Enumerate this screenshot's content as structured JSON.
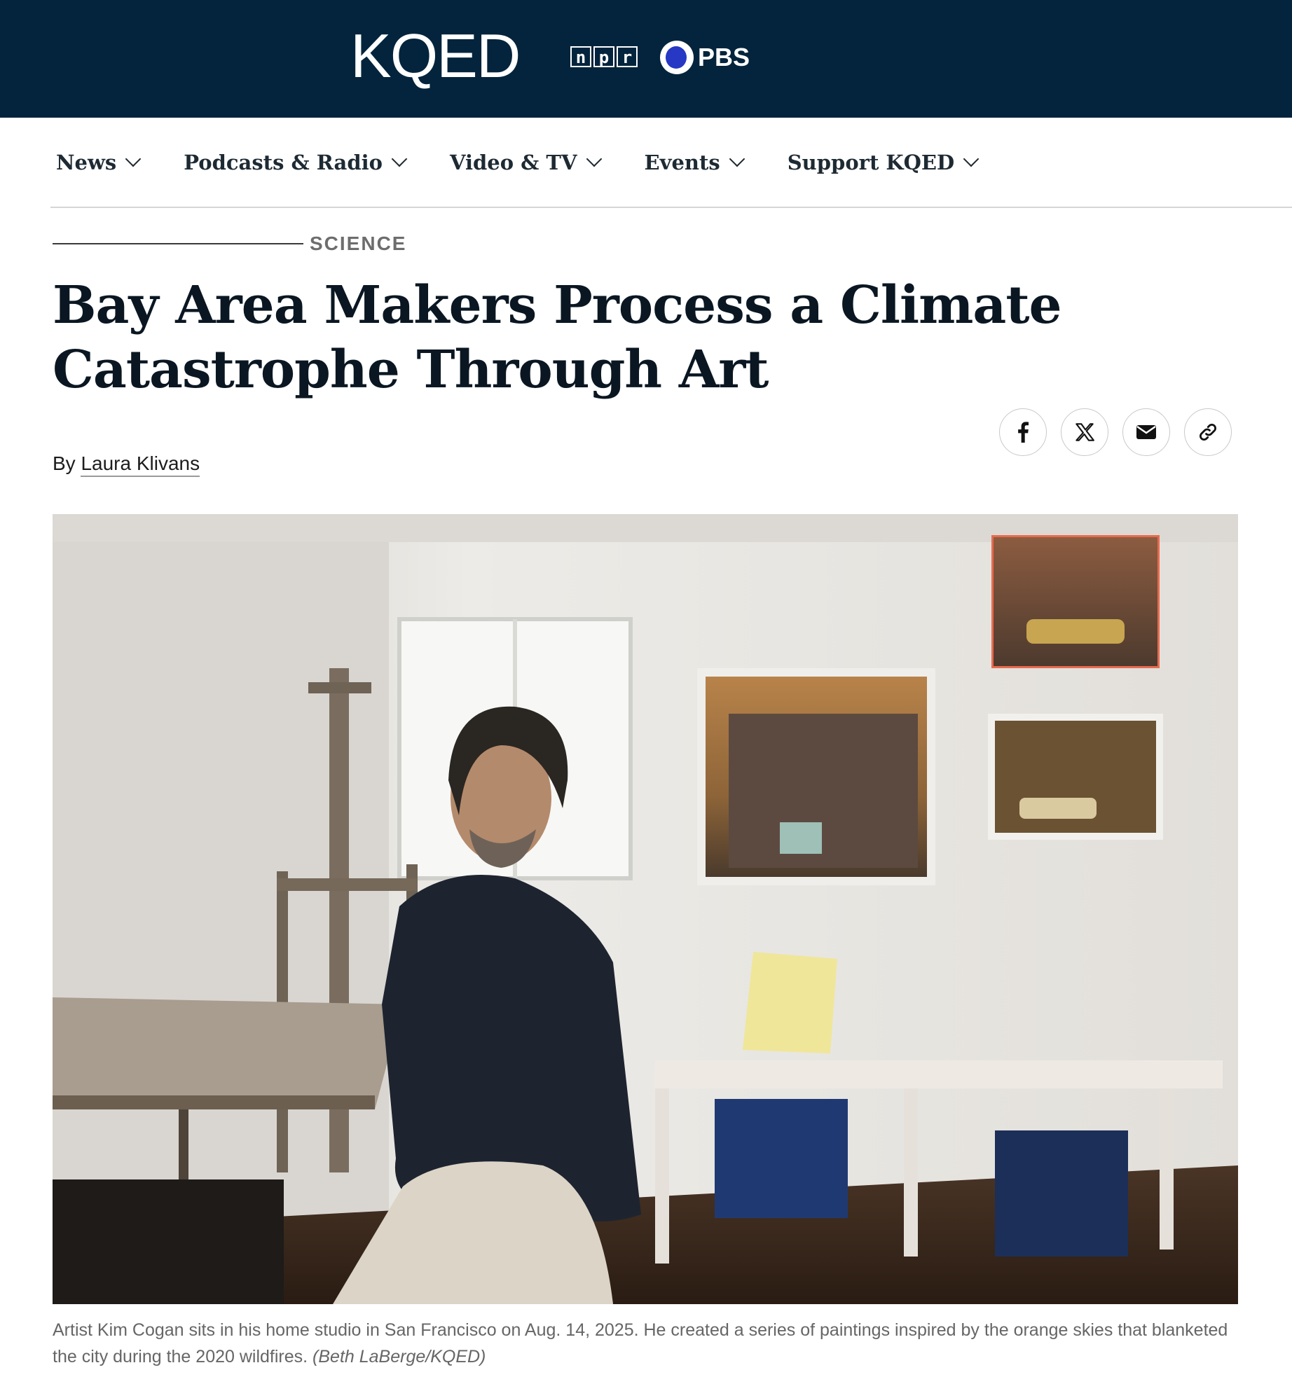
{
  "brand": {
    "logo": "KQED",
    "partners": {
      "npr_letters": [
        "n",
        "p",
        "r"
      ],
      "pbs": "PBS"
    }
  },
  "nav": {
    "items": [
      {
        "label": "News"
      },
      {
        "label": "Podcasts & Radio"
      },
      {
        "label": "Video & TV"
      },
      {
        "label": "Events"
      },
      {
        "label": "Support KQED"
      }
    ]
  },
  "article": {
    "section": "SCIENCE",
    "headline": "Bay Area Makers Process a Climate Catastrophe Through Art",
    "byline_prefix": "By",
    "author": "Laura Klivans",
    "share_icons": [
      "facebook-icon",
      "x-icon",
      "email-icon",
      "link-icon"
    ],
    "caption": "Artist Kim Cogan sits in his home studio in San Francisco on Aug. 14, 2025. He created a series of paintings inspired by the orange skies that blanketed the city during the 2020 wildfires.",
    "credit": "(Beth LaBerge/KQED)"
  },
  "colors": {
    "brand_bar": "#03243c",
    "headline": "#0a1722",
    "caption": "#666666"
  }
}
